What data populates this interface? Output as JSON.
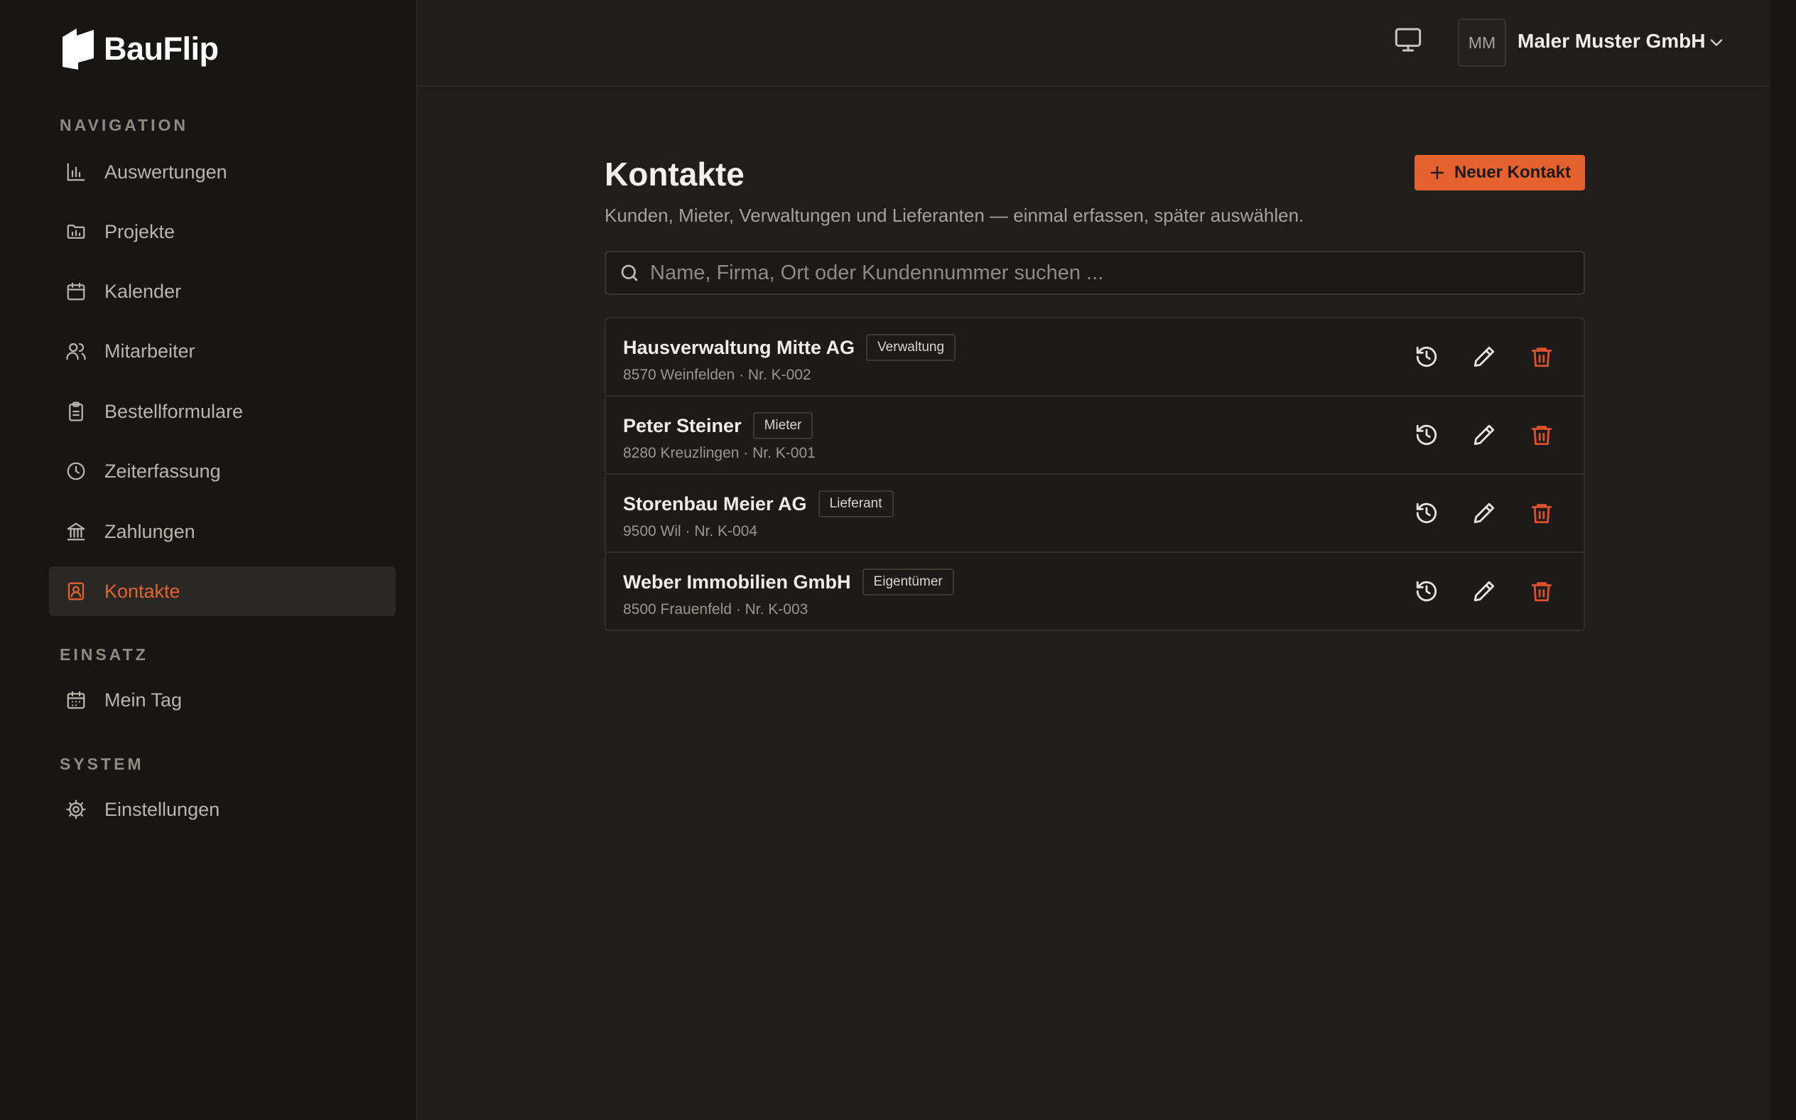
{
  "brand": {
    "name": "BauFlip",
    "accent": "#e5622f"
  },
  "sidebar": {
    "sections": [
      {
        "label": "NAVIGATION"
      },
      {
        "label": "EINSATZ"
      },
      {
        "label": "SYSTEM"
      }
    ],
    "items": [
      {
        "label": "Auswertungen",
        "icon": "bar-chart-icon"
      },
      {
        "label": "Projekte",
        "icon": "folder-chart-icon"
      },
      {
        "label": "Kalender",
        "icon": "calendar-icon"
      },
      {
        "label": "Mitarbeiter",
        "icon": "users-icon"
      },
      {
        "label": "Bestellformulare",
        "icon": "clipboard-icon"
      },
      {
        "label": "Zeiterfassung",
        "icon": "clock-icon"
      },
      {
        "label": "Zahlungen",
        "icon": "bank-icon"
      },
      {
        "label": "Kontakte",
        "icon": "contact-icon",
        "active": true
      },
      {
        "label": "Mein Tag",
        "icon": "calendar-days-icon"
      },
      {
        "label": "Einstellungen",
        "icon": "gear-icon"
      }
    ]
  },
  "topbar": {
    "avatar_initials": "MM",
    "company": "Maler Muster GmbH"
  },
  "main": {
    "title": "Kontakte",
    "subtitle": "Kunden, Mieter, Verwaltungen und Lieferanten — einmal erfassen, später auswählen.",
    "new_button_label": "Neuer Kontakt",
    "search_placeholder": "Name, Firma, Ort oder Kundennummer suchen ...",
    "contacts": [
      {
        "name": "Hausverwaltung Mitte AG",
        "type": "Verwaltung",
        "meta": "8570 Weinfelden · Nr. K-002"
      },
      {
        "name": "Peter Steiner",
        "type": "Mieter",
        "meta": "8280 Kreuzlingen · Nr. K-001"
      },
      {
        "name": "Storenbau Meier AG",
        "type": "Lieferant",
        "meta": "9500 Wil · Nr. K-004"
      },
      {
        "name": "Weber Immobilien GmbH",
        "type": "Eigentümer",
        "meta": "8500 Frauenfeld · Nr. K-003"
      }
    ]
  }
}
